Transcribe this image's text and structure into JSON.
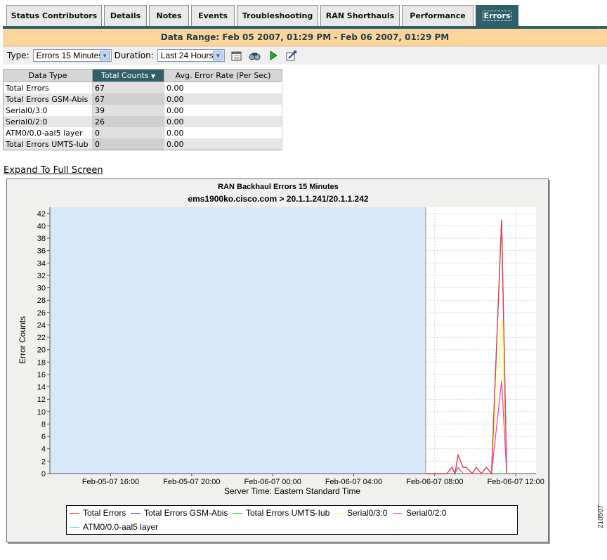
{
  "tabs": [
    {
      "label": "Status Contributors"
    },
    {
      "label": "Details"
    },
    {
      "label": "Notes"
    },
    {
      "label": "Events"
    },
    {
      "label": "Troubleshooting"
    },
    {
      "label": "RAN Shorthauls"
    },
    {
      "label": "Performance"
    },
    {
      "label": "Errors"
    }
  ],
  "data_range": "Data Range: Feb 05 2007, 01:29 PM - Feb 06 2007, 01:29 PM",
  "toolbar": {
    "type_label": "Type:",
    "type_value": "Errors 15 Minutes",
    "duration_label": "Duration:",
    "duration_value": "Last 24 Hours",
    "icons": [
      "calendar-icon",
      "find-icon",
      "play-icon",
      "export-icon"
    ]
  },
  "table": {
    "headers": [
      "Data Type",
      "Total Counts",
      "Avg. Error Rate (Per Sec)"
    ],
    "rows": [
      [
        "Total Errors",
        "67",
        "0.00"
      ],
      [
        "Total Errors GSM-Abis",
        "67",
        "0.00"
      ],
      [
        "Serial0/3:0",
        "39",
        "0.00"
      ],
      [
        "Serial0/2:0",
        "26",
        "0.00"
      ],
      [
        "ATM0/0.0-aal5 layer",
        "0",
        "0.00"
      ],
      [
        "Total Errors UMTS-Iub",
        "0",
        "0.00"
      ]
    ]
  },
  "expand_link": "Expand To Full Screen",
  "chart_data": {
    "type": "line",
    "title": "RAN Backhaul Errors 15 Minutes",
    "subtitle": "ems1900ko.cisco.com > 20.1.1.241/20.1.1.242",
    "xlabel": "Server Time: Eastern Standard Time",
    "ylabel": "Error Counts",
    "ylim": [
      0,
      43
    ],
    "yticks": [
      0,
      2,
      4,
      6,
      8,
      10,
      12,
      14,
      16,
      18,
      20,
      22,
      24,
      26,
      28,
      30,
      32,
      34,
      36,
      38,
      40,
      42
    ],
    "x_unit": "hours since Feb-05-07 13:00",
    "xlim": [
      0,
      24
    ],
    "xtick_labels": [
      {
        "t": 3,
        "label": "Feb-05-07 16:00"
      },
      {
        "t": 7,
        "label": "Feb-05-07 20:00"
      },
      {
        "t": 11,
        "label": "Feb-06-07 00:00"
      },
      {
        "t": 15,
        "label": "Feb-06-07 04:00"
      },
      {
        "t": 19,
        "label": "Feb-06-07 08:00"
      },
      {
        "t": 23,
        "label": "Feb-06-07 12:00"
      }
    ],
    "no_data_region": [
      0,
      18.55
    ],
    "series": [
      {
        "name": "Total Errors",
        "color": "#e04040",
        "points": [
          [
            18.55,
            0
          ],
          [
            19.6,
            0
          ],
          [
            19.85,
            1
          ],
          [
            20.0,
            0
          ],
          [
            20.15,
            3
          ],
          [
            20.4,
            1
          ],
          [
            20.55,
            1
          ],
          [
            20.85,
            0
          ],
          [
            21.05,
            1
          ],
          [
            21.3,
            0
          ],
          [
            21.55,
            1
          ],
          [
            21.8,
            0
          ],
          [
            22.3,
            41
          ],
          [
            22.55,
            0
          ]
        ]
      },
      {
        "name": "Total Errors GSM-Abis",
        "color": "#4444cc",
        "points": [
          [
            18.55,
            0
          ],
          [
            19.6,
            0
          ],
          [
            19.85,
            1
          ],
          [
            20.0,
            0
          ],
          [
            20.15,
            3
          ],
          [
            20.4,
            1
          ],
          [
            20.55,
            1
          ],
          [
            20.85,
            0
          ],
          [
            21.05,
            1
          ],
          [
            21.3,
            0
          ],
          [
            21.55,
            1
          ],
          [
            21.8,
            0
          ],
          [
            22.3,
            41
          ],
          [
            22.55,
            0
          ]
        ]
      },
      {
        "name": "Total Errors UMTS-Iub",
        "color": "#22cc22",
        "points": [
          [
            18.55,
            0
          ],
          [
            22.55,
            0
          ]
        ]
      },
      {
        "name": "Serial0/3:0",
        "color": "#ffff66",
        "points": [
          [
            18.55,
            0
          ],
          [
            20.0,
            0
          ],
          [
            20.15,
            1
          ],
          [
            20.4,
            0
          ],
          [
            21.8,
            0
          ],
          [
            22.3,
            25
          ],
          [
            22.55,
            0
          ]
        ]
      },
      {
        "name": "Serial0/2:0",
        "color": "#ee44cc",
        "points": [
          [
            18.55,
            0
          ],
          [
            20.0,
            0
          ],
          [
            20.15,
            1
          ],
          [
            20.4,
            0
          ],
          [
            21.8,
            0
          ],
          [
            22.3,
            15
          ],
          [
            22.55,
            0
          ]
        ]
      },
      {
        "name": "ATM0/0.0-aal5 layer",
        "color": "#66ddee",
        "points": [
          [
            18.55,
            0
          ],
          [
            22.55,
            0
          ]
        ]
      }
    ],
    "legend": "bottom",
    "grid": true
  },
  "figure_code": "210507"
}
